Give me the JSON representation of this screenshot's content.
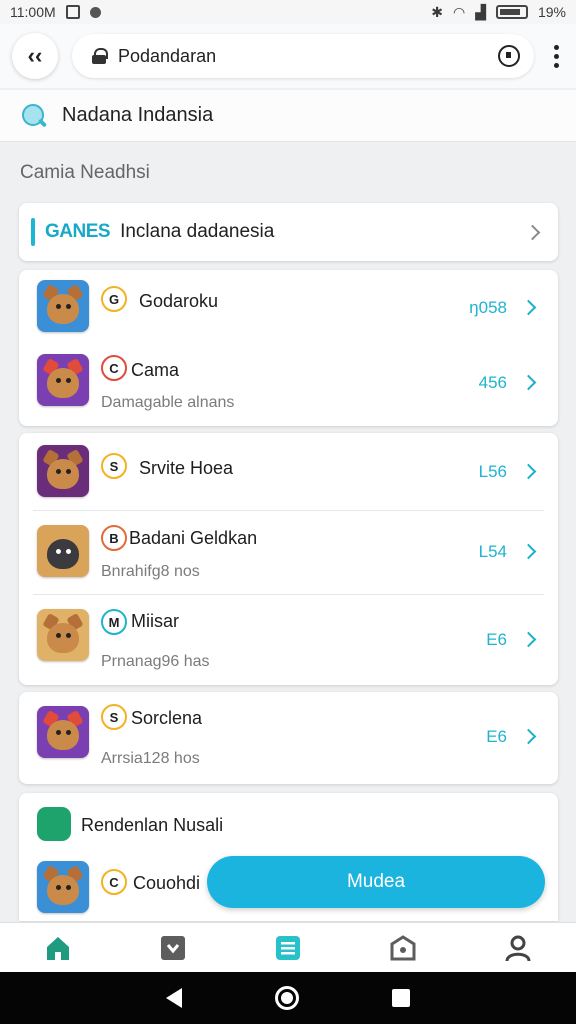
{
  "status_bar": {
    "time": "11:00M",
    "battery": "19%"
  },
  "browser": {
    "url": "Podandaran"
  },
  "search": {
    "title": "Nadana Indansia"
  },
  "section": {
    "label": "Camia Neadhsi"
  },
  "games_header": {
    "tag": "GANES",
    "text": "Inclana dadanesia"
  },
  "group1": [
    {
      "title": "Godaroku",
      "badge": "G",
      "subtitle": "",
      "value": "ŋ058"
    },
    {
      "title": "Cama",
      "badge": "C",
      "subtitle": "Damagable alnans",
      "value": "456"
    }
  ],
  "group2": [
    {
      "title": "Srvite Hoea",
      "badge": "S",
      "subtitle": "",
      "value": "L56"
    },
    {
      "title": "Badani Geldkan",
      "badge": "B",
      "subtitle": "Bnrahifg8 nos",
      "value": "L54"
    },
    {
      "title": "Miisar",
      "badge": "M",
      "subtitle": "Prnanag96 has",
      "value": "E6"
    }
  ],
  "group3": [
    {
      "title": "Sorclena",
      "badge": "S",
      "subtitle": "Arrsia128 hos",
      "value": "E6"
    }
  ],
  "group4": {
    "header": "Rendenlan Nusali",
    "item": {
      "title": "Couohdi",
      "badge": "C"
    }
  },
  "float_button": {
    "label": "Mudea"
  },
  "nav": [
    "home-icon",
    "download-icon",
    "list-icon",
    "store-icon",
    "profile-icon"
  ],
  "colors": {
    "accent": "#1bb4de",
    "nav_active": "#1f9c7f"
  }
}
